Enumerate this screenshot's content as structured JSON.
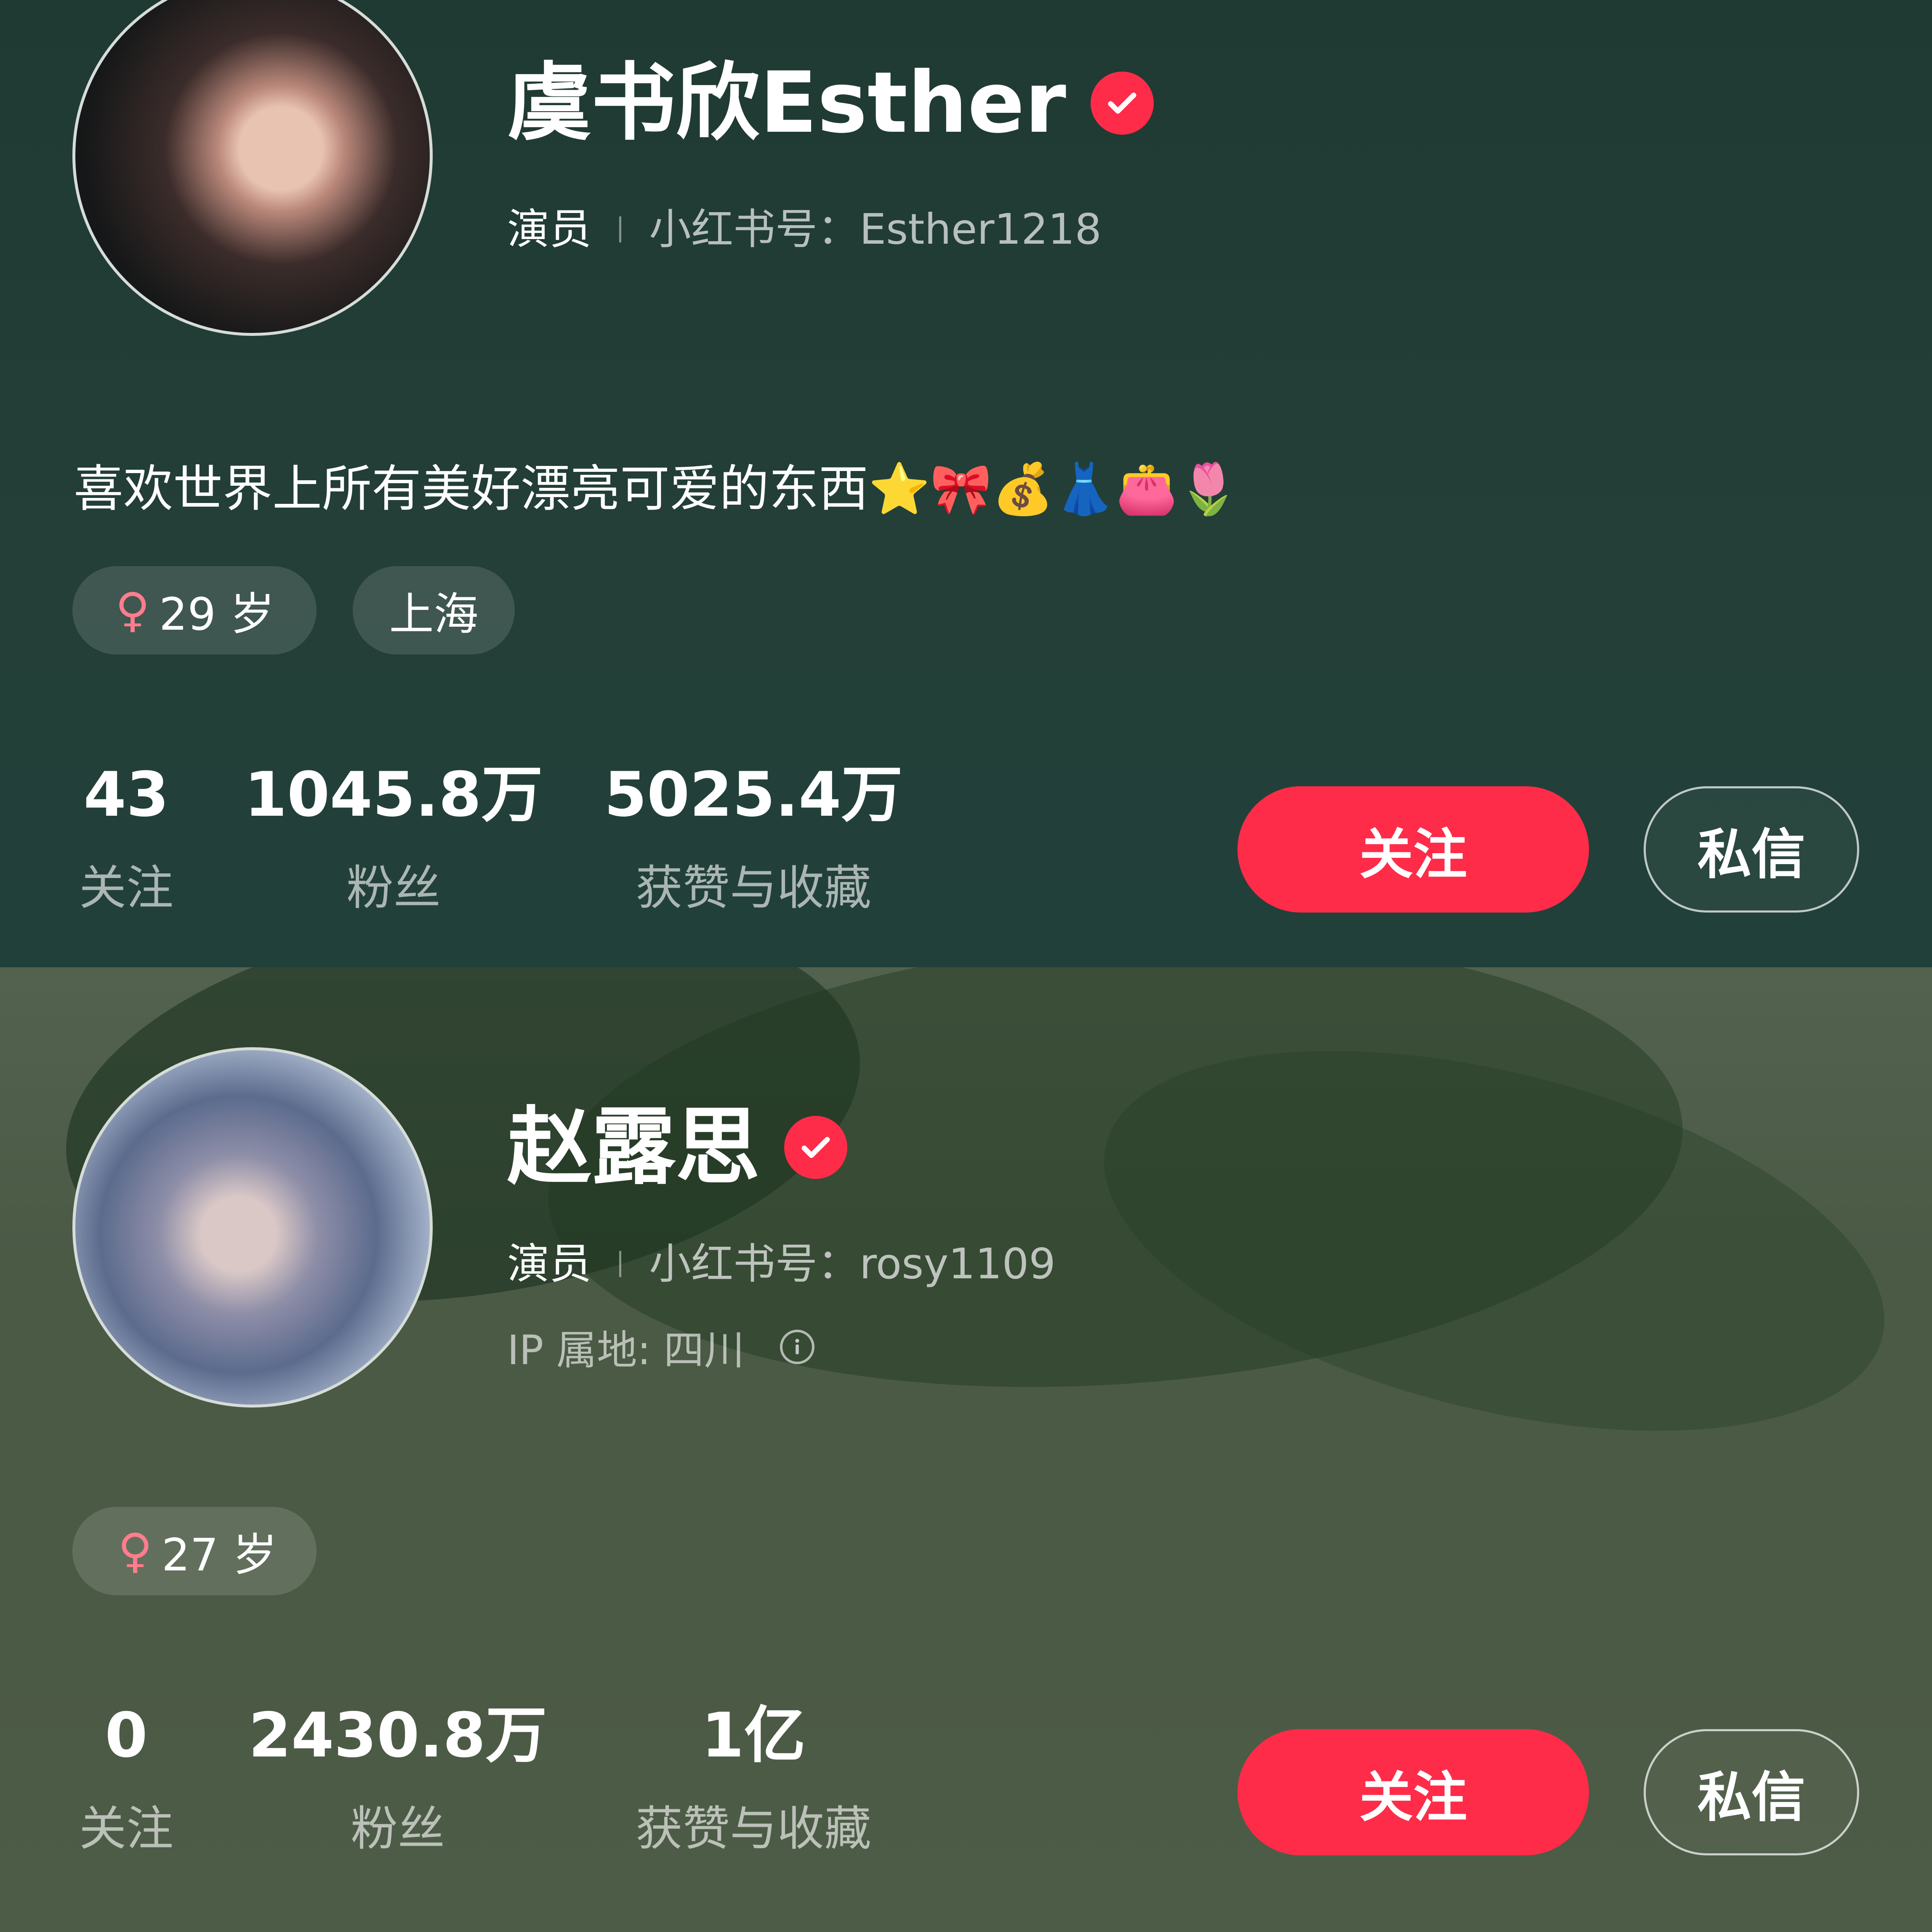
{
  "colors": {
    "accent": "#fe2c49",
    "female": "#ff7d8d"
  },
  "profiles": [
    {
      "name": "虞书欣Esther",
      "verified_icon": "verified-check-icon",
      "role": "演员",
      "redbook_id": "小红书号：Esther1218",
      "bio": "喜欢世界上所有美好漂亮可爱的东西⭐🎀💰👗👛🌷",
      "gender_symbol": "♀",
      "age": "29 岁",
      "location": "上海",
      "stats": [
        {
          "value": "43",
          "label": "关注"
        },
        {
          "value": "1045.8万",
          "label": "粉丝"
        },
        {
          "value": "5025.4万",
          "label": "获赞与收藏"
        }
      ],
      "follow_label": "关注",
      "message_label": "私信"
    },
    {
      "name": "赵露思",
      "verified_icon": "verified-check-icon",
      "role": "演员",
      "redbook_id": "小红书号：rosy1109",
      "ip_location": "IP 属地: 四川",
      "gender_symbol": "♀",
      "age": "27 岁",
      "stats": [
        {
          "value": "0",
          "label": "关注"
        },
        {
          "value": "2430.8万",
          "label": "粉丝"
        },
        {
          "value": "1亿",
          "label": "获赞与收藏"
        }
      ],
      "follow_label": "关注",
      "message_label": "私信"
    }
  ]
}
